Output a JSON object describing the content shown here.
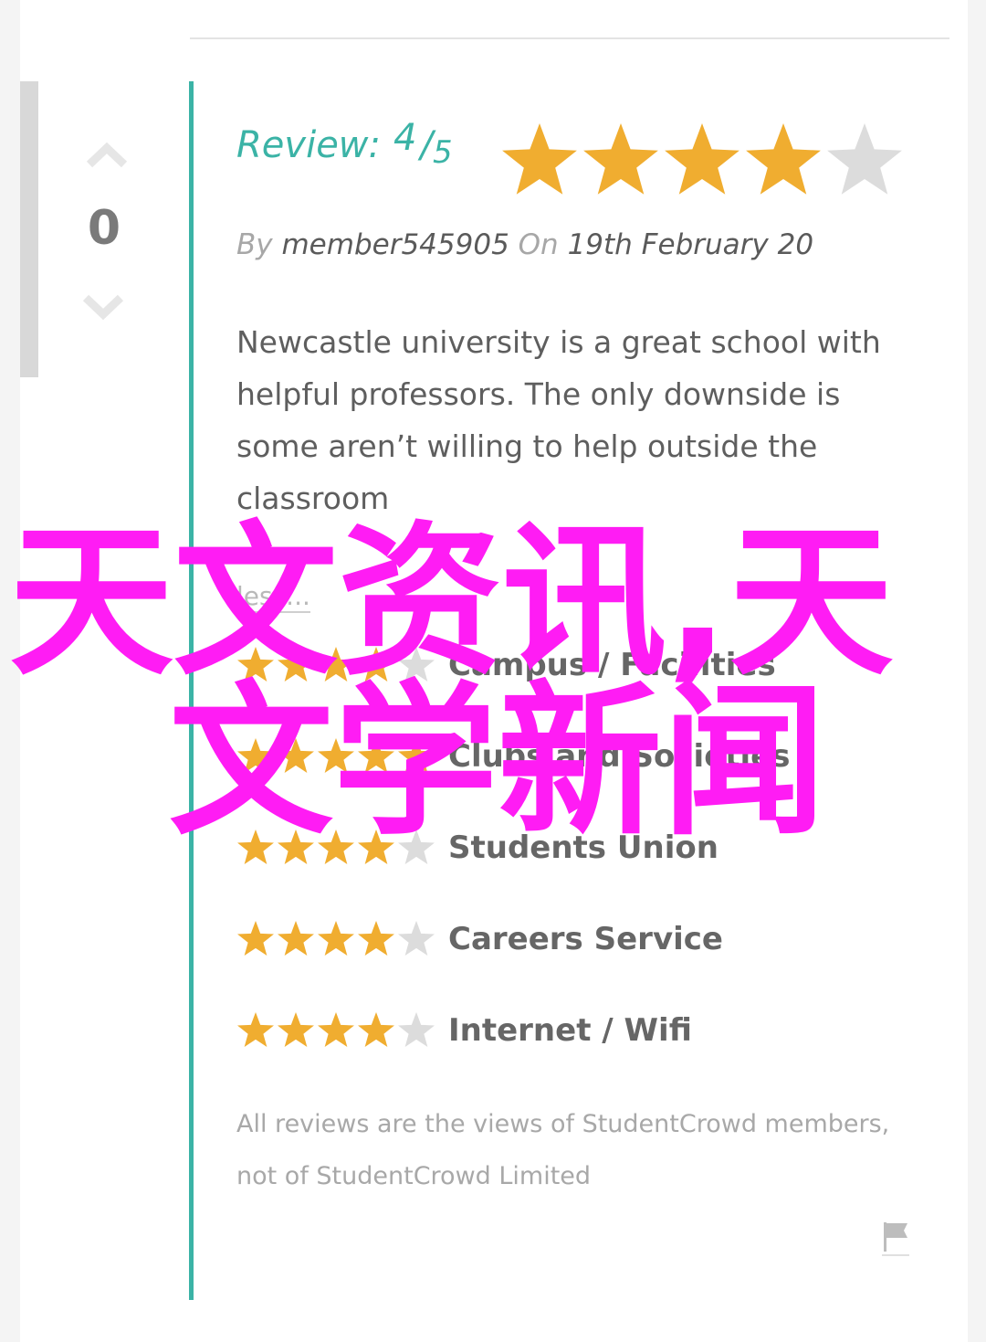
{
  "vote": {
    "count": "0"
  },
  "review": {
    "title_label": "Review:",
    "score": "4",
    "slash": "/",
    "out_of": "5",
    "rating": 4,
    "max_rating": 5,
    "by_label": "By",
    "author": "member545905",
    "on_label": "On",
    "date": "19th February 20",
    "body": "Newcastle university is a great school with helpful professors. The only downside is some aren’t willing to help outside the classroom",
    "less_link": "less..."
  },
  "categories": [
    {
      "label": "Campus / Facilities",
      "rating": 4
    },
    {
      "label": "Clubs and Societies",
      "rating": 5
    },
    {
      "label": "Students Union",
      "rating": 4
    },
    {
      "label": "Careers Service",
      "rating": 4
    },
    {
      "label": "Internet / Wifi",
      "rating": 4
    }
  ],
  "disclaimer": "All reviews are the views of StudentCrowd members, not of StudentCrowd Limited",
  "overlay": {
    "line1": "天文资讯,天",
    "line2": "文学新闻"
  },
  "colors": {
    "accent": "#3bb3a6",
    "star_filled": "#f0ad30",
    "star_empty": "#dcdcdc",
    "overlay_text": "#ff1cf4"
  },
  "icons": {
    "vote_up": "chevron-up-icon",
    "vote_down": "chevron-down-icon",
    "flag": "flag-icon"
  }
}
